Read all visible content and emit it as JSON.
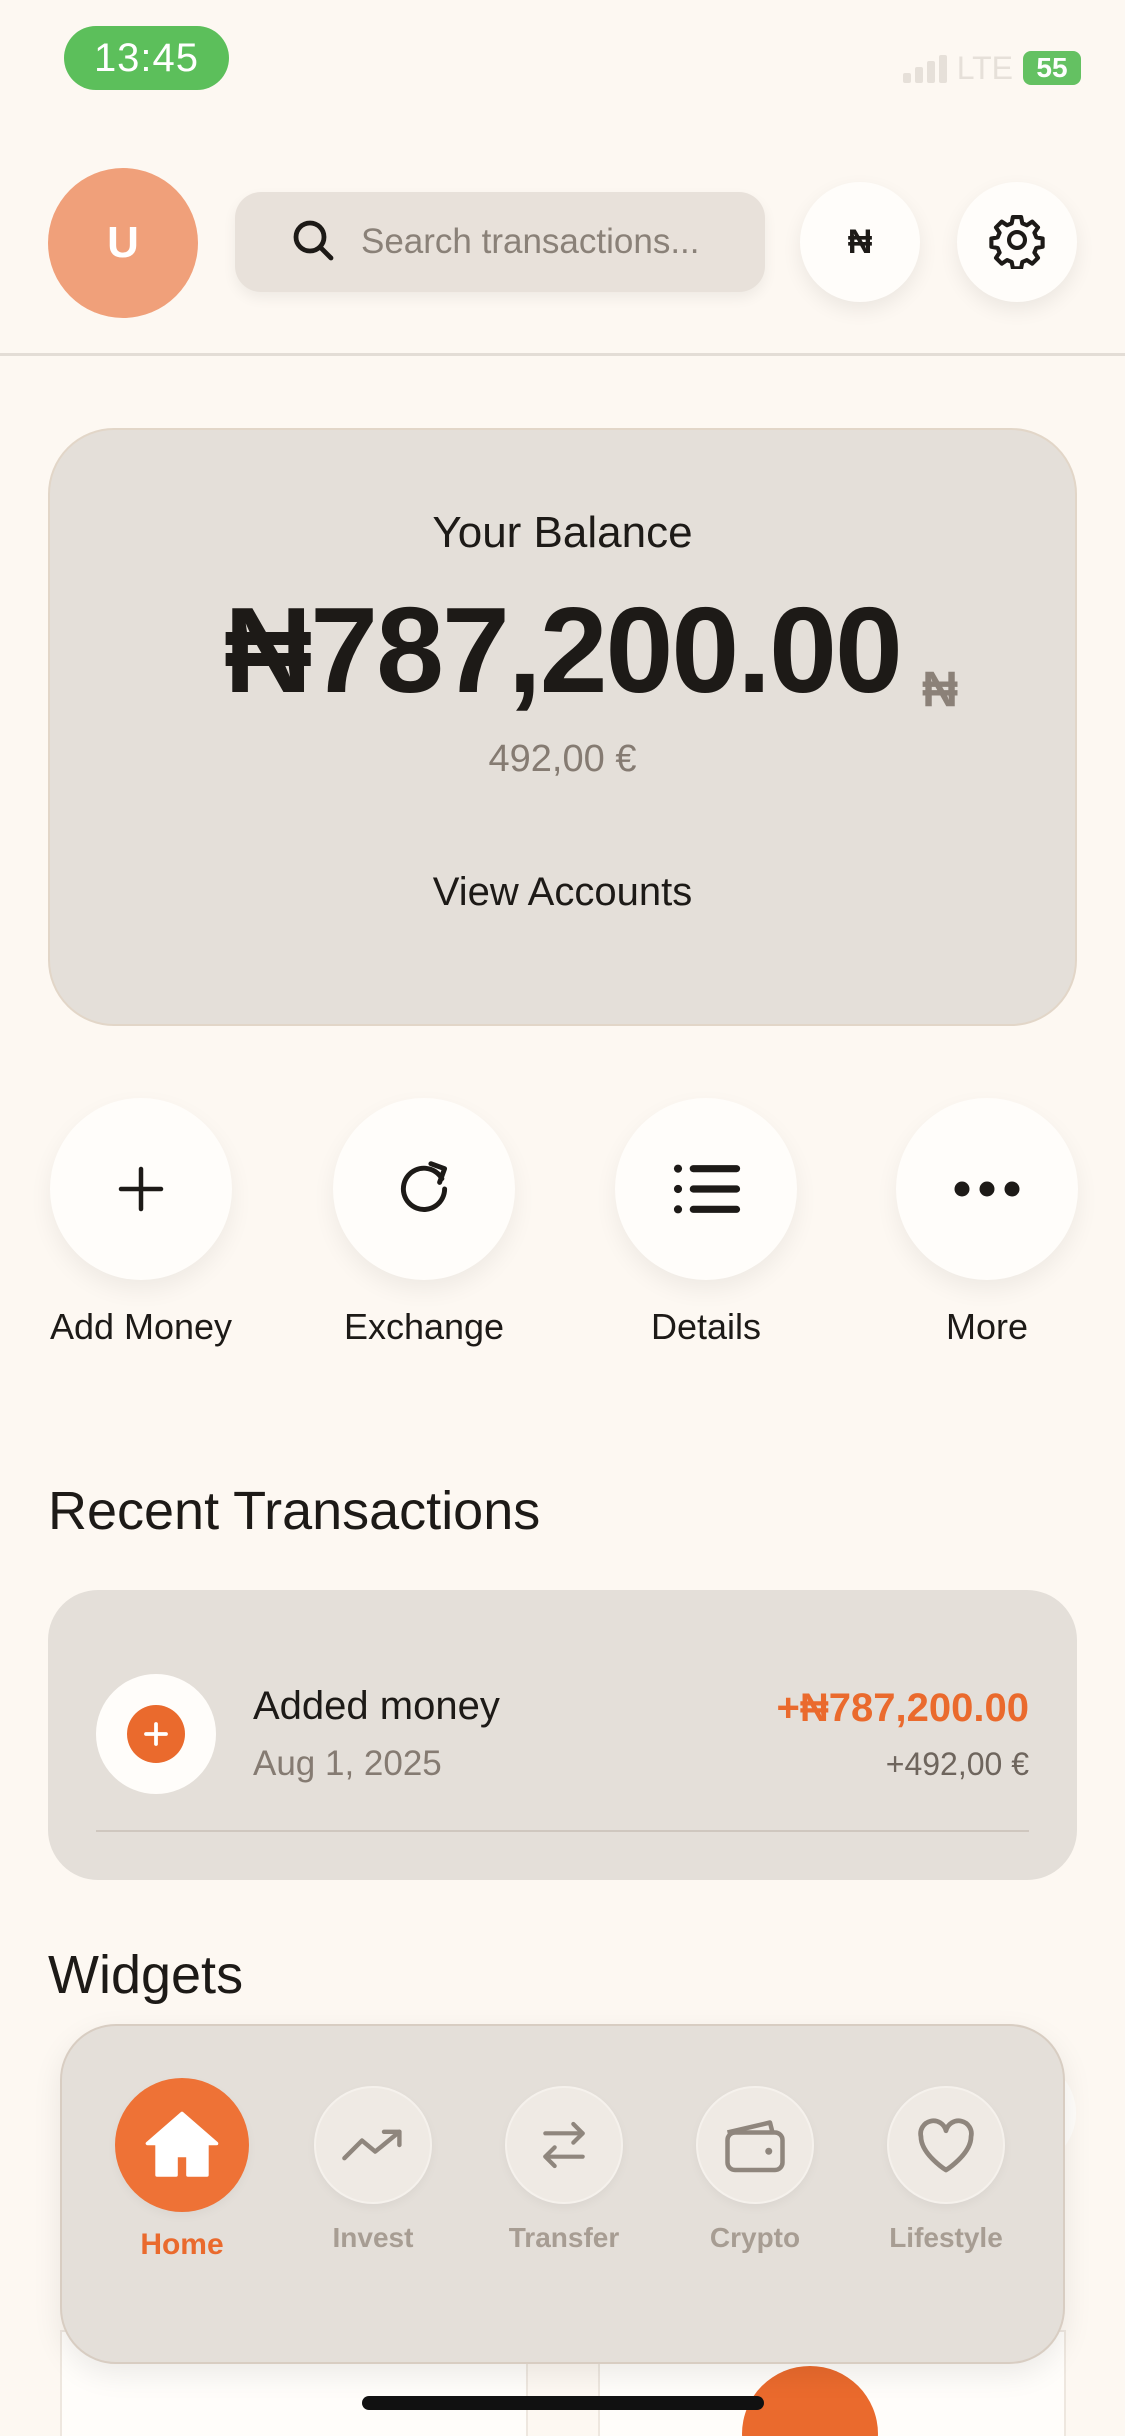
{
  "status_bar": {
    "time": "13:45",
    "network": "LTE",
    "battery": "55"
  },
  "header": {
    "avatar_initial": "U",
    "search_placeholder": "Search transactions...",
    "currency_symbol": "₦"
  },
  "balance": {
    "label": "Your Balance",
    "amount": "₦787,200.00",
    "currency_badge": "₦",
    "converted": "492,00 €",
    "view_accounts": "View Accounts"
  },
  "actions": [
    {
      "label": "Add Money",
      "icon": "plus-icon"
    },
    {
      "label": "Exchange",
      "icon": "refresh-icon"
    },
    {
      "label": "Details",
      "icon": "list-icon"
    },
    {
      "label": "More",
      "icon": "more-icon"
    }
  ],
  "recent": {
    "title": "Recent Transactions",
    "items": [
      {
        "title": "Added money",
        "date": "Aug 1, 2025",
        "amount": "+₦787,200.00",
        "converted": "+492,00 €",
        "icon": "plus-icon"
      }
    ]
  },
  "widgets": {
    "title": "Widgets"
  },
  "bottom_nav": [
    {
      "label": "Home",
      "icon": "home-icon",
      "active": true
    },
    {
      "label": "Invest",
      "icon": "trend-up-icon",
      "active": false
    },
    {
      "label": "Transfer",
      "icon": "transfer-icon",
      "active": false
    },
    {
      "label": "Crypto",
      "icon": "wallet-icon",
      "active": false
    },
    {
      "label": "Lifestyle",
      "icon": "heart-icon",
      "active": false
    }
  ],
  "colors": {
    "accent": "#ea6a2d",
    "background": "#fdf8f2",
    "card": "#e4dfd9",
    "status_green": "#5cbf5b"
  }
}
